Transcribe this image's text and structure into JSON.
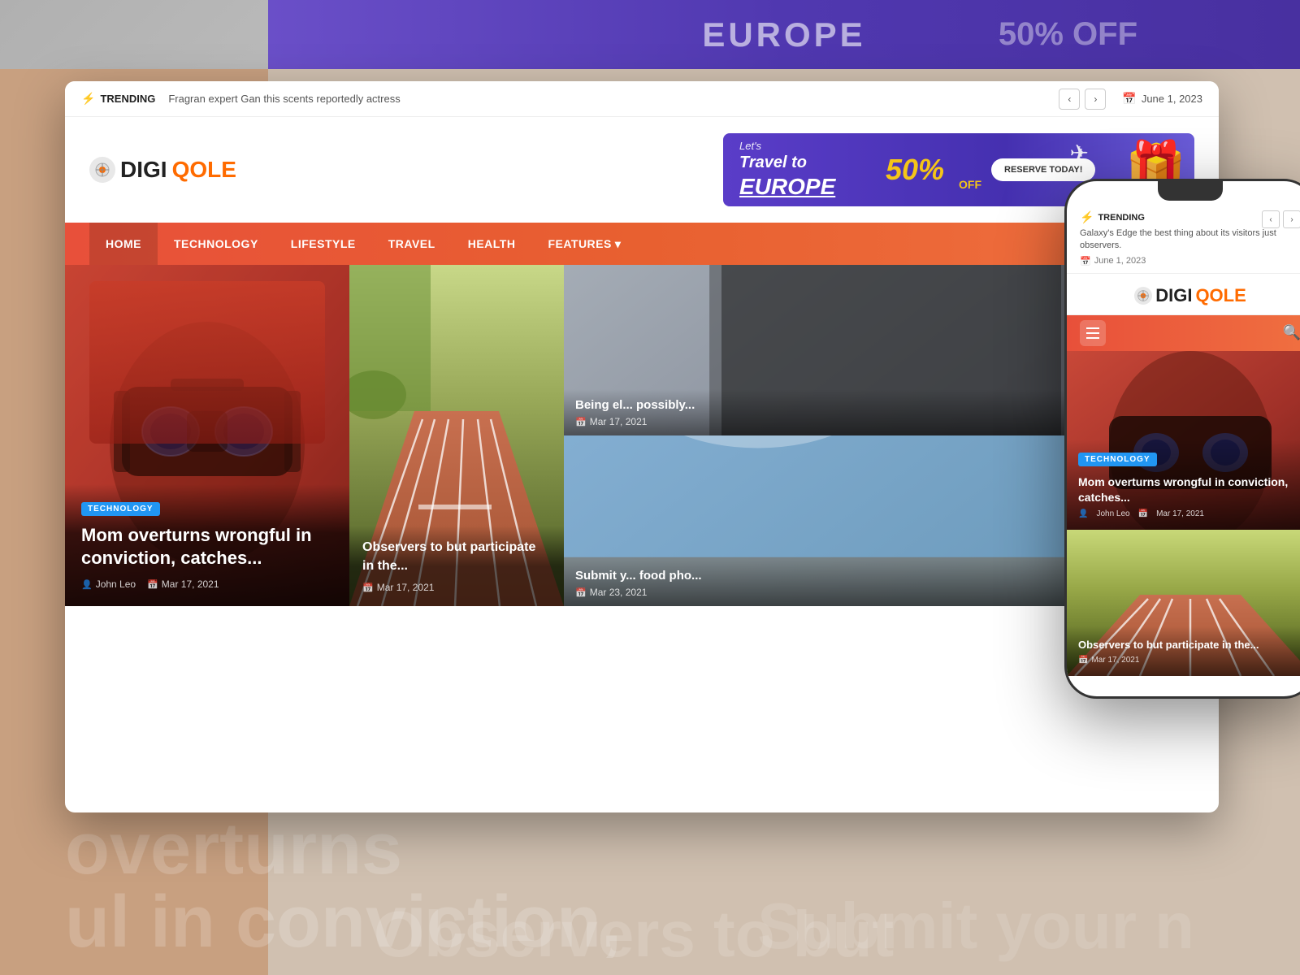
{
  "site": {
    "name": "DIGIQOLE",
    "logo_icon": "⚙",
    "title": "DIGIQOLE"
  },
  "trending": {
    "label": "TRENDING",
    "text": "Fragran expert Gan this scents reportedly actress",
    "date": "June 1, 2023"
  },
  "ad": {
    "lets": "Let's",
    "travel": "Travel to",
    "europe": "EUROPE",
    "percent": "50%",
    "off": "OFF",
    "button": "RESERVE TODAY!",
    "size": "ADS 1110 x 180 px"
  },
  "nav": {
    "items": [
      "HOME",
      "TECHNOLOGY",
      "LIFESTYLE",
      "TRAVEL",
      "HEALTH",
      "FEATURES"
    ]
  },
  "articles": [
    {
      "tag": "TECHNOLOGY",
      "title": "Mom overturns wrongful in conviction, catches...",
      "author": "John Leo",
      "date": "Mar 17, 2021"
    },
    {
      "title": "Observers to but participate in the...",
      "date": "Mar 17, 2021"
    },
    {
      "title": "Being el... possibly...",
      "date": "Mar 17, 2021"
    },
    {
      "title": "Submit y... food pho...",
      "date": "Mar 23, 2021"
    }
  ],
  "mobile": {
    "trending_text": "Galaxy's Edge the best thing about its visitors just observers.",
    "date": "June 1, 2023",
    "card1_title": "Mom overturns wrongful in conviction, catches...",
    "card1_author": "John Leo",
    "card1_date": "Mar 17, 2021",
    "card2_title": "Observers to but participate in the...",
    "card2_date": "Mar 17, 2021"
  },
  "bg": {
    "bottom_left": "overturns",
    "bottom_left2": "ul in conviction,",
    "bottom_center": "Observers to but",
    "bottom_right": "Submit your n"
  }
}
